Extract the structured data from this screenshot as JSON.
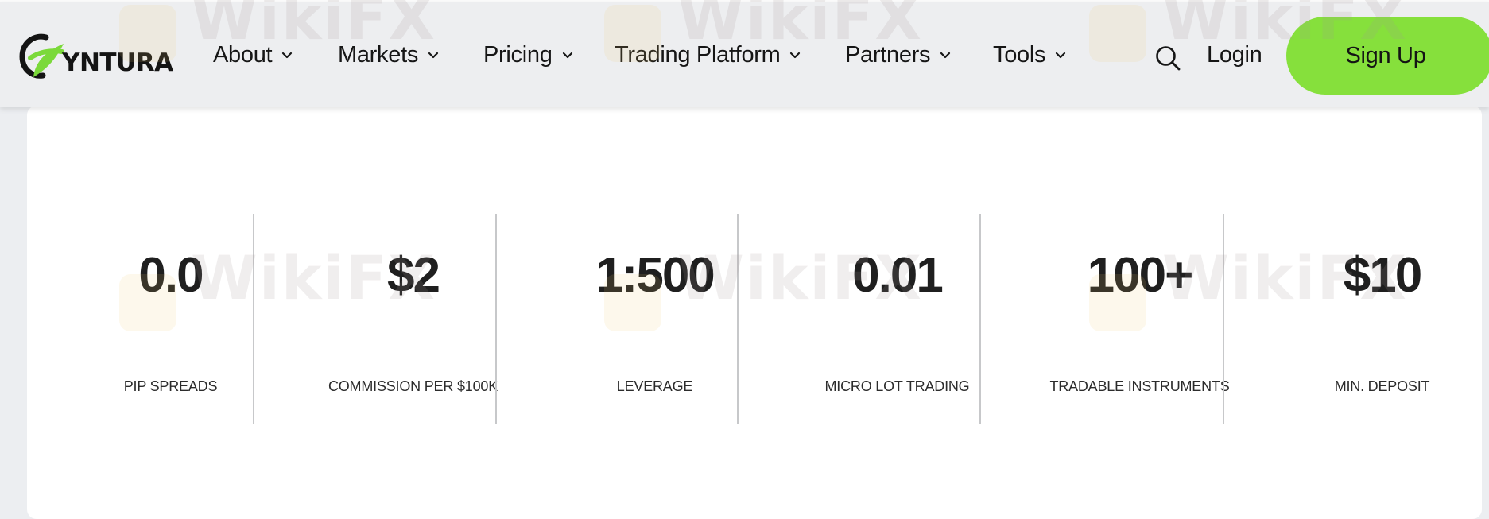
{
  "brand": {
    "logo_text": "YNTURA",
    "accent_color": "#86e03c"
  },
  "nav": {
    "items": [
      {
        "label": "About"
      },
      {
        "label": "Markets"
      },
      {
        "label": "Pricing"
      },
      {
        "label": "Trading Platform"
      },
      {
        "label": "Partners"
      },
      {
        "label": "Tools"
      }
    ],
    "search_icon": "search-icon",
    "login_label": "Login",
    "signup_label": "Sign Up"
  },
  "stats": [
    {
      "value": "0.0",
      "label": "PIP SPREADS"
    },
    {
      "value": "$2",
      "label": "COMMISSION PER $100K"
    },
    {
      "value": "1:500",
      "label": "LEVERAGE"
    },
    {
      "value": "0.01",
      "label": "MICRO LOT TRADING"
    },
    {
      "value": "100+",
      "label": "TRADABLE INSTRUMENTS"
    },
    {
      "value": "$10",
      "label": "MIN. DEPOSIT"
    }
  ],
  "watermark": {
    "text": "WikiFX"
  }
}
